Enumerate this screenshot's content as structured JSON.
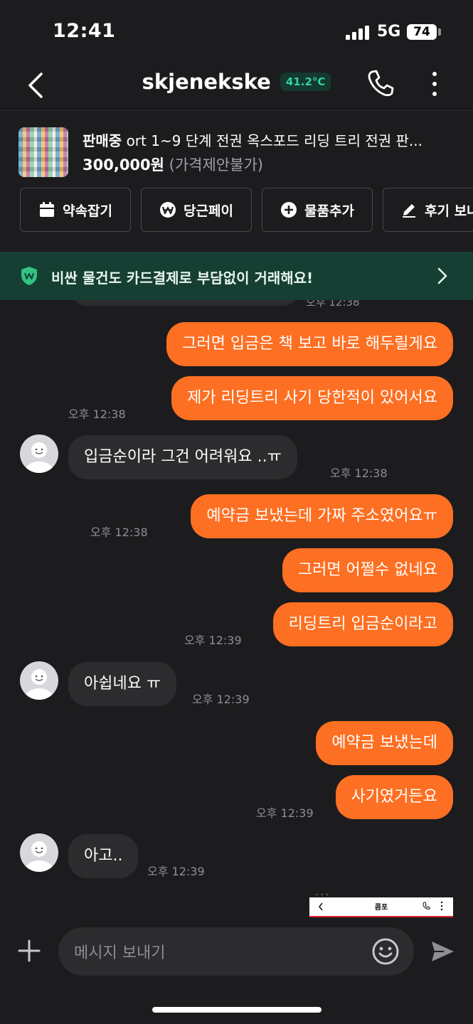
{
  "status_bar": {
    "time": "12:41",
    "network": "5G",
    "battery": "74"
  },
  "header": {
    "title": "skjenekske",
    "temperature": "41.2°C"
  },
  "product": {
    "status": "판매중",
    "name": "ort 1~9 단계 전권 옥스포드 리딩 트리 전권 판...",
    "price": "300,000원",
    "price_note": "(가격제안불가)"
  },
  "actions": [
    {
      "label": "약속잡기",
      "icon": "calendar-icon"
    },
    {
      "label": "당근페이",
      "icon": "won-icon"
    },
    {
      "label": "물품추가",
      "icon": "plus-circle-icon"
    },
    {
      "label": "후기 보내기",
      "icon": "pencil-icon"
    }
  ],
  "banner": {
    "text": "비싼 물건도 카드결제로 부담없이 거래해요!"
  },
  "messages": {
    "prev_time": "오후 12:38",
    "m1": "그러면 입금은 책 보고 바로 해두릴게요",
    "m2": "제가 리딩트리 사기 당한적이 있어서요",
    "t2": "오후 12:38",
    "m3": "입금순이라 그건 어려워요 ..ㅠ",
    "t3": "오후 12:38",
    "m4": "예약금 보냈는데 가짜 주소였어요ㅠ",
    "t4": "오후 12:38",
    "m5": "그러면 어쩔수 없네요",
    "m6": "리딩트리 입금순이라고",
    "t6": "오후 12:39",
    "m7": "아쉽네요 ㅠ",
    "t7": "오후 12:39",
    "m8": "예약금 보냈는데",
    "m9": "사기였거든요",
    "t9": "오후 12:39",
    "m10": "아고..",
    "t10": "오후 12:39",
    "shared_image_title": "콤포"
  },
  "input": {
    "placeholder": "메시지 보내기"
  },
  "colors": {
    "outgoing": "#fd6f22",
    "incoming": "#2c2c2e",
    "banner": "#143f32",
    "temperature": "#32d2a2"
  }
}
